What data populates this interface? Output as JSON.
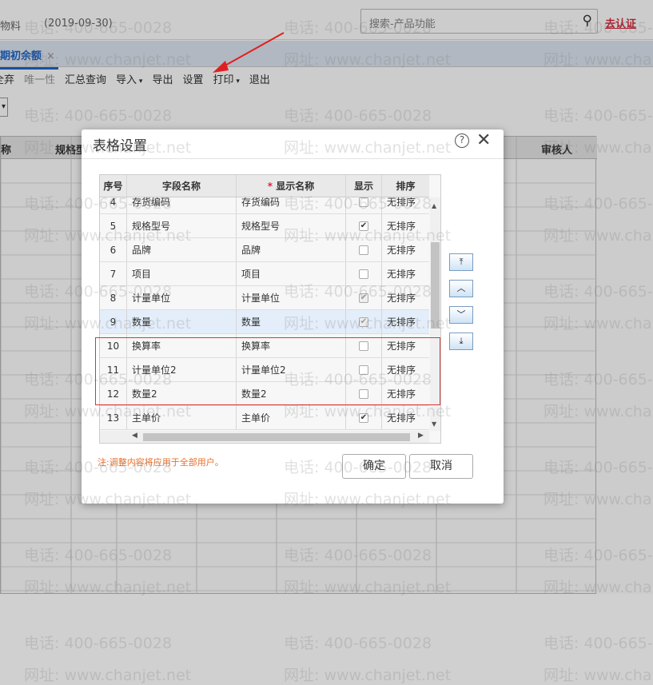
{
  "topbar": {
    "crumb": "物料",
    "date": "(2019-09-30)",
    "search_placeholder": "搜索-产品功能",
    "cert": "去认证"
  },
  "tab": {
    "label": "期初余额",
    "close": "×"
  },
  "toolbar": [
    "全弃",
    "唯一性",
    "汇总查询",
    "导入",
    "导出",
    "设置",
    "打印",
    "退出"
  ],
  "grid_headers": [
    "称",
    "规格型",
    "审核人"
  ],
  "watermark": {
    "phone": "电话: 400-665-0028",
    "site": "网址: www.chanjet.net"
  },
  "dialog": {
    "title": "表格设置",
    "columns": [
      "序号",
      "字段名称",
      "显示名称",
      "显示",
      "排序"
    ],
    "required_mark": "*",
    "rows": [
      {
        "no": "4",
        "field": "存货编码",
        "display": "存货编码",
        "shown": false,
        "disabled": false,
        "sort": "无排序"
      },
      {
        "no": "5",
        "field": "规格型号",
        "display": "规格型号",
        "shown": true,
        "disabled": false,
        "sort": "无排序"
      },
      {
        "no": "6",
        "field": "品牌",
        "display": "品牌",
        "shown": false,
        "disabled": false,
        "sort": "无排序"
      },
      {
        "no": "7",
        "field": "项目",
        "display": "项目",
        "shown": false,
        "disabled": false,
        "sort": "无排序"
      },
      {
        "no": "8",
        "field": "计量单位",
        "display": "计量单位",
        "shown": true,
        "disabled": true,
        "sort": "无排序"
      },
      {
        "no": "9",
        "field": "数量",
        "display": "数量",
        "shown": true,
        "disabled": true,
        "sort": "无排序",
        "selected": true
      },
      {
        "no": "10",
        "field": "换算率",
        "display": "换算率",
        "shown": false,
        "disabled": false,
        "sort": "无排序"
      },
      {
        "no": "11",
        "field": "计量单位2",
        "display": "计量单位2",
        "shown": false,
        "disabled": false,
        "sort": "无排序"
      },
      {
        "no": "12",
        "field": "数量2",
        "display": "数量2",
        "shown": false,
        "disabled": false,
        "sort": "无排序"
      },
      {
        "no": "13",
        "field": "主单价",
        "display": "主单价",
        "shown": true,
        "disabled": false,
        "sort": "无排序"
      }
    ],
    "note": "注:调整内容将应用于全部用户。",
    "ok": "确定",
    "cancel": "取消"
  },
  "colors": {
    "accent": "#1e64c8",
    "highlight": "#d33333",
    "note": "#e8702a"
  }
}
